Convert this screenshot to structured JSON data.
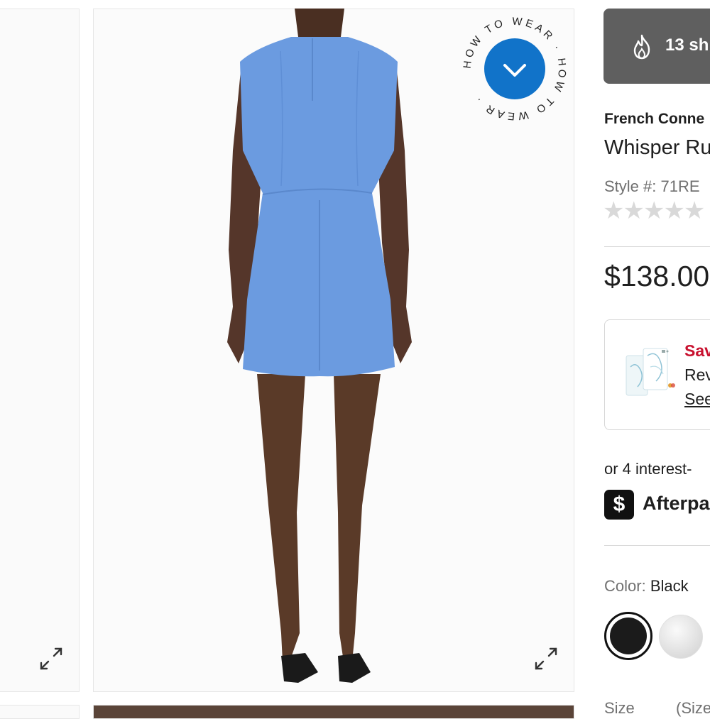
{
  "gallery": {
    "how_to_wear_label": "HOW TO WEAR",
    "expand_icon": "expand-arrows-icon",
    "chevron_icon": "chevron-down-icon"
  },
  "shoppers": {
    "icon": "flame-icon",
    "text": "13 sh"
  },
  "product": {
    "brand": "French Conne",
    "title": "Whisper Ru",
    "style": "Style #: 71RE",
    "rating_stars": "★★★★★",
    "price": "$138.00"
  },
  "promo": {
    "line1": "Sav",
    "line2": "Rev",
    "line3": "See"
  },
  "payments": {
    "installments": "or 4 interest-",
    "afterpay_icon": "$",
    "afterpay_label": "Afterpa"
  },
  "color": {
    "label": "Color:",
    "value": "Black",
    "swatches": [
      "Black",
      "Silver"
    ]
  },
  "size": {
    "label": "Size",
    "guide": "(Size"
  },
  "colors": {
    "dress": "#6b9be0",
    "badge_bg": "#5f5f5f",
    "promo_red": "#c8102e",
    "how_to_wear_blue": "#1173c9"
  }
}
